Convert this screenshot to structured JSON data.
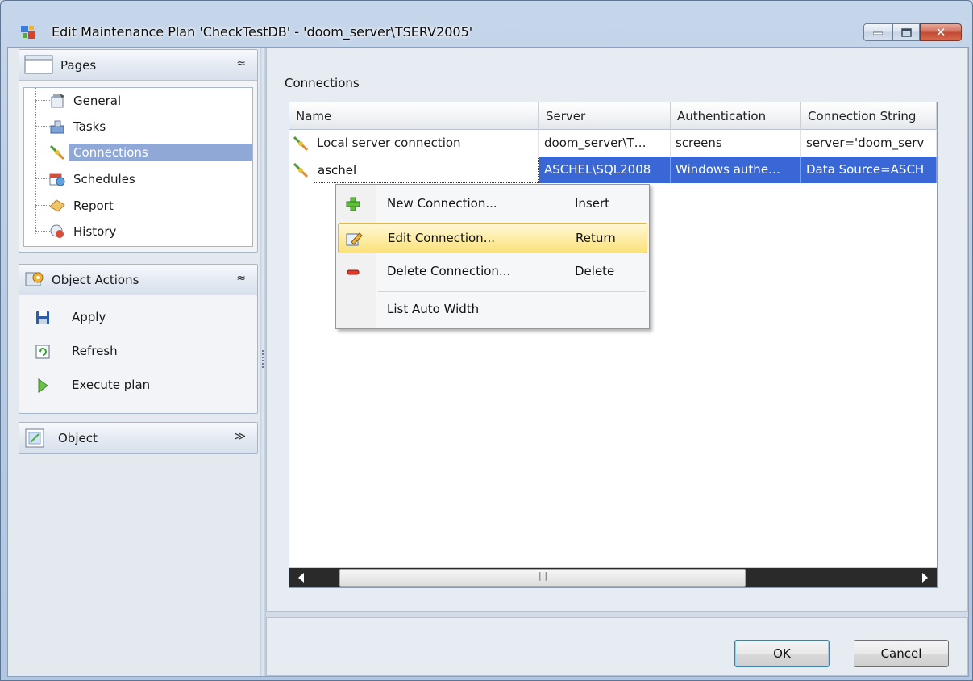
{
  "window": {
    "title": "Edit Maintenance Plan 'CheckTestDB' - 'doom_server\\TSERV2005'",
    "close_glyph": "✕"
  },
  "sidebar": {
    "pages": {
      "title": "Pages",
      "toggle": "≈",
      "items": [
        {
          "label": "General",
          "icon": "general-icon"
        },
        {
          "label": "Tasks",
          "icon": "tasks-icon"
        },
        {
          "label": "Connections",
          "icon": "connection-plug-icon",
          "selected": true
        },
        {
          "label": "Schedules",
          "icon": "schedules-icon"
        },
        {
          "label": "Report",
          "icon": "report-icon"
        },
        {
          "label": "History",
          "icon": "history-icon"
        }
      ]
    },
    "object_actions": {
      "title": "Object Actions",
      "toggle": "≈",
      "items": [
        {
          "label": "Apply",
          "icon": "save-icon"
        },
        {
          "label": "Refresh",
          "icon": "refresh-icon"
        },
        {
          "label": "Execute plan",
          "icon": "play-icon"
        }
      ]
    },
    "object": {
      "title": "Object",
      "toggle": "≫"
    }
  },
  "main": {
    "heading": "Connections",
    "columns": [
      "Name",
      "Server",
      "Authentication",
      "Connection String"
    ],
    "rows": [
      {
        "name": "Local server connection",
        "server": "doom_server\\T…",
        "auth": "screens",
        "conn": "server='doom_serv"
      },
      {
        "name": "aschel",
        "server": "ASCHEL\\SQL2008",
        "auth": "Windows authe…",
        "conn": "Data Source=ASCH"
      }
    ],
    "scroll_grip": "|||"
  },
  "context_menu": {
    "items": [
      {
        "label": "New Connection...",
        "shortcut": "Insert",
        "icon": "add-icon"
      },
      {
        "label": "Edit Connection...",
        "shortcut": "Return",
        "icon": "edit-icon",
        "highlighted": true
      },
      {
        "label": "Delete Connection...",
        "shortcut": "Delete",
        "icon": "delete-icon"
      },
      {
        "label": "List Auto Width",
        "shortcut": ""
      }
    ]
  },
  "buttons": {
    "ok": "OK",
    "cancel": "Cancel"
  },
  "colors": {
    "selection": "#3a67d6",
    "tree_selection": "#8fa8d6",
    "menu_highlight": "#fbe27a"
  }
}
